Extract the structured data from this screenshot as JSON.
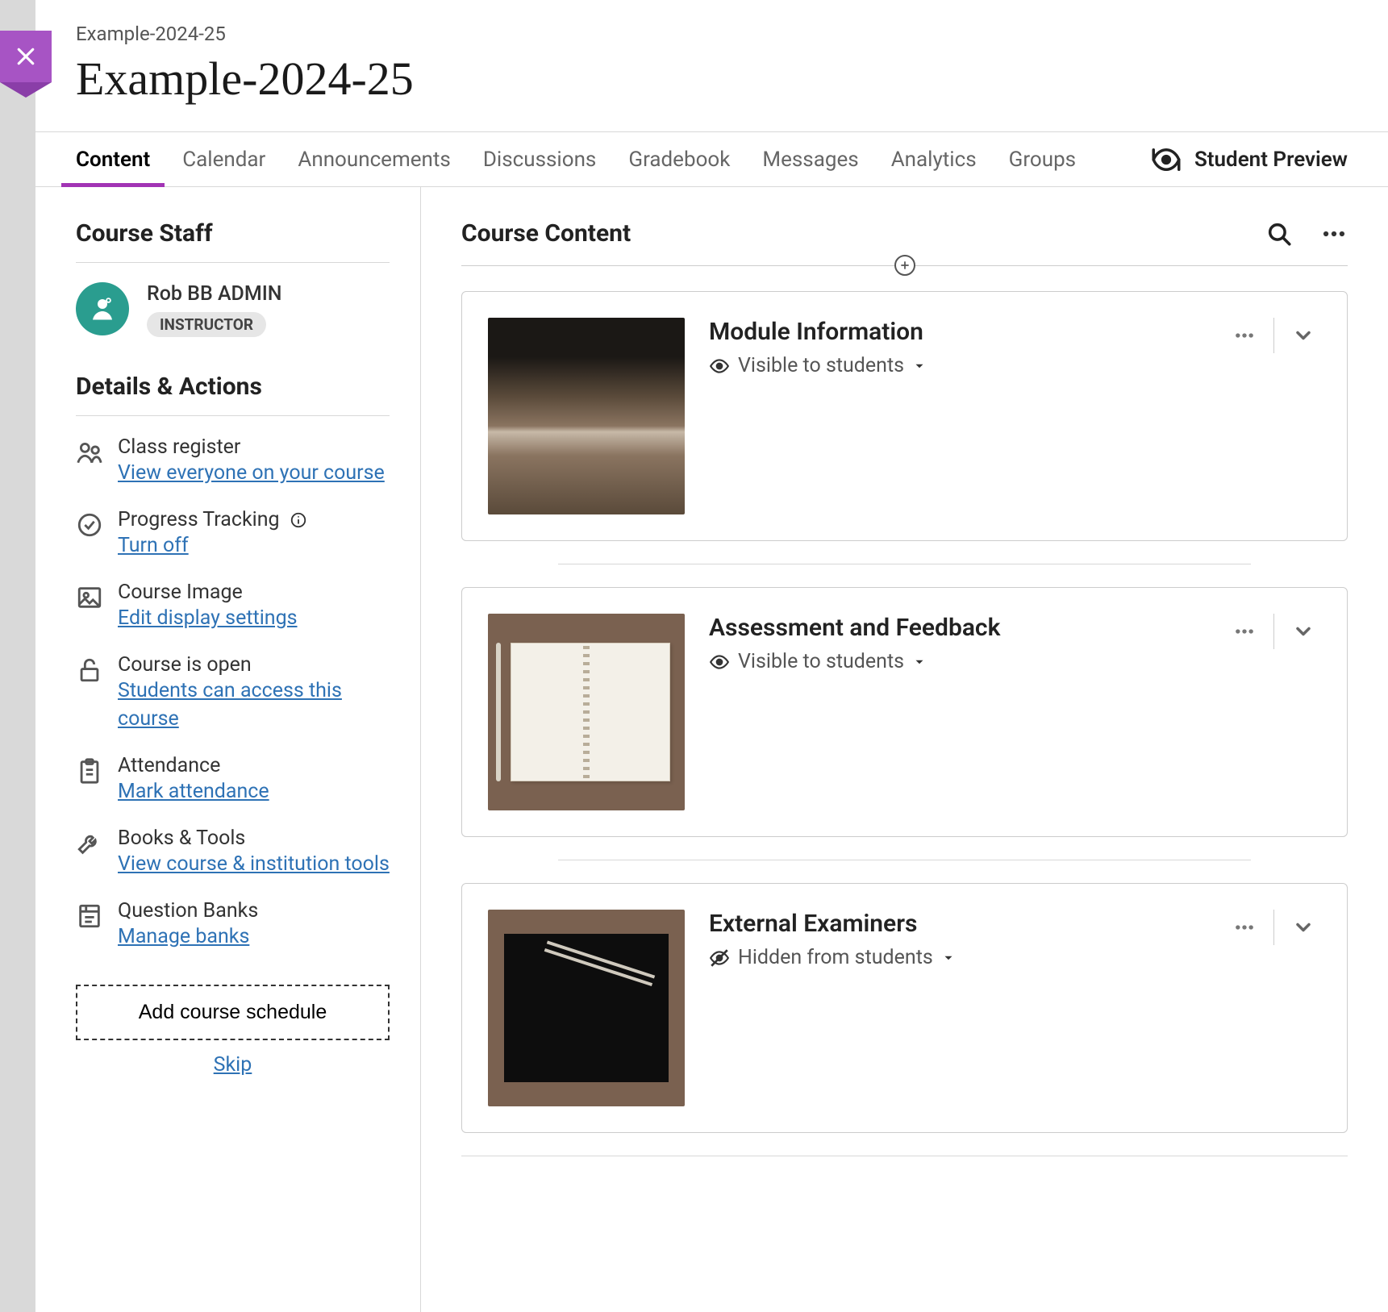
{
  "breadcrumb": "Example-2024-25",
  "page_title": "Example-2024-25",
  "tabs": [
    {
      "label": "Content",
      "active": true
    },
    {
      "label": "Calendar",
      "active": false
    },
    {
      "label": "Announcements",
      "active": false
    },
    {
      "label": "Discussions",
      "active": false
    },
    {
      "label": "Gradebook",
      "active": false
    },
    {
      "label": "Messages",
      "active": false
    },
    {
      "label": "Analytics",
      "active": false
    },
    {
      "label": "Groups",
      "active": false
    }
  ],
  "student_preview_label": "Student Preview",
  "sidebar": {
    "staff_heading": "Course Staff",
    "staff_name": "Rob BB ADMIN",
    "staff_role": "INSTRUCTOR",
    "details_heading": "Details & Actions",
    "items": [
      {
        "label": "Class register",
        "link": "View everyone on your course"
      },
      {
        "label": "Progress Tracking",
        "link": "Turn off",
        "info": true
      },
      {
        "label": "Course Image",
        "link": "Edit display settings"
      },
      {
        "label": "Course is open",
        "link": "Students can access this course"
      },
      {
        "label": "Attendance",
        "link": "Mark attendance"
      },
      {
        "label": "Books & Tools",
        "link": "View course & institution tools"
      },
      {
        "label": "Question Banks",
        "link": "Manage banks"
      }
    ],
    "schedule_button": "Add course schedule",
    "skip_link": "Skip"
  },
  "content": {
    "heading": "Course Content",
    "cards": [
      {
        "title": "Module Information",
        "visibility": "Visible to students",
        "hidden": false
      },
      {
        "title": "Assessment and Feedback",
        "visibility": "Visible to students",
        "hidden": false
      },
      {
        "title": "External Examiners",
        "visibility": "Hidden from students",
        "hidden": true
      }
    ]
  }
}
